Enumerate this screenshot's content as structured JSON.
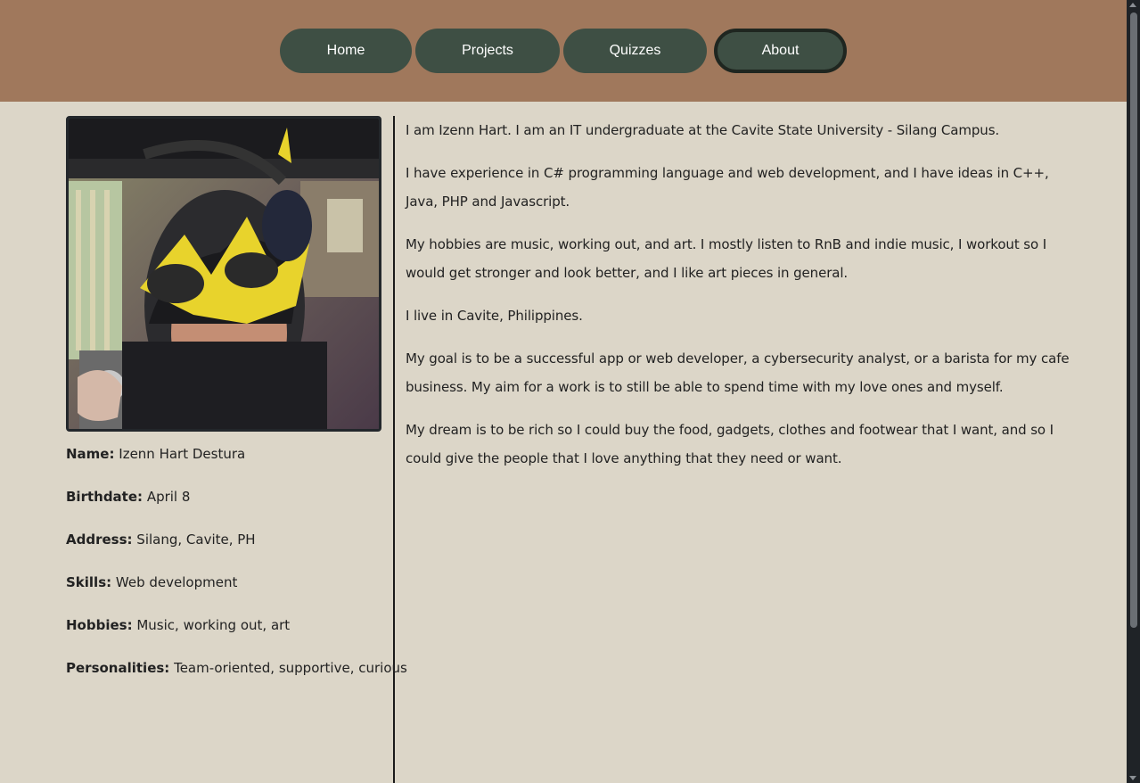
{
  "nav": {
    "home": "Home",
    "projects": "Projects",
    "quizzes": "Quizzes",
    "about": "About",
    "active": "About"
  },
  "profile": {
    "photo_icon": "profile-photo",
    "name_label": "Name:",
    "name_value": "Izenn Hart Destura",
    "birthdate_label": "Birthdate:",
    "birthdate_value": "April 8",
    "address_label": "Address:",
    "address_value": "Silang, Cavite, PH",
    "skills_label": "Skills:",
    "skills_value": "Web development",
    "hobbies_label": "Hobbies:",
    "hobbies_value": "Music, working out, art",
    "personalities_label": "Personalities:",
    "personalities_value": "Team-oriented, supportive, curious"
  },
  "about": {
    "p1": "I am Izenn Hart. I am an IT undergraduate at the Cavite State University - Silang Campus.",
    "p2": "I have experience in C# programming language and web development, and I have ideas in C++, Java, PHP and Javascript.",
    "p3": "My hobbies are music, working out, and art. I mostly listen to RnB and indie music, I workout so I would get stronger and look better, and I like art pieces in general.",
    "p4": "I live in Cavite, Philippines.",
    "p5": "My goal is to be a successful app or web developer, a cybersecurity analyst, or a barista for my cafe business. My aim for a work is to still be able to spend time with my love ones and myself.",
    "p6": "My dream is to be rich so I could buy the food, gadgets, clothes and footwear that I want, and so I could give the people that I love anything that they need or want."
  },
  "colors": {
    "header_bg": "#a0785c",
    "nav_btn": "#3e4f44",
    "page_bg": "#dcd6c8"
  }
}
